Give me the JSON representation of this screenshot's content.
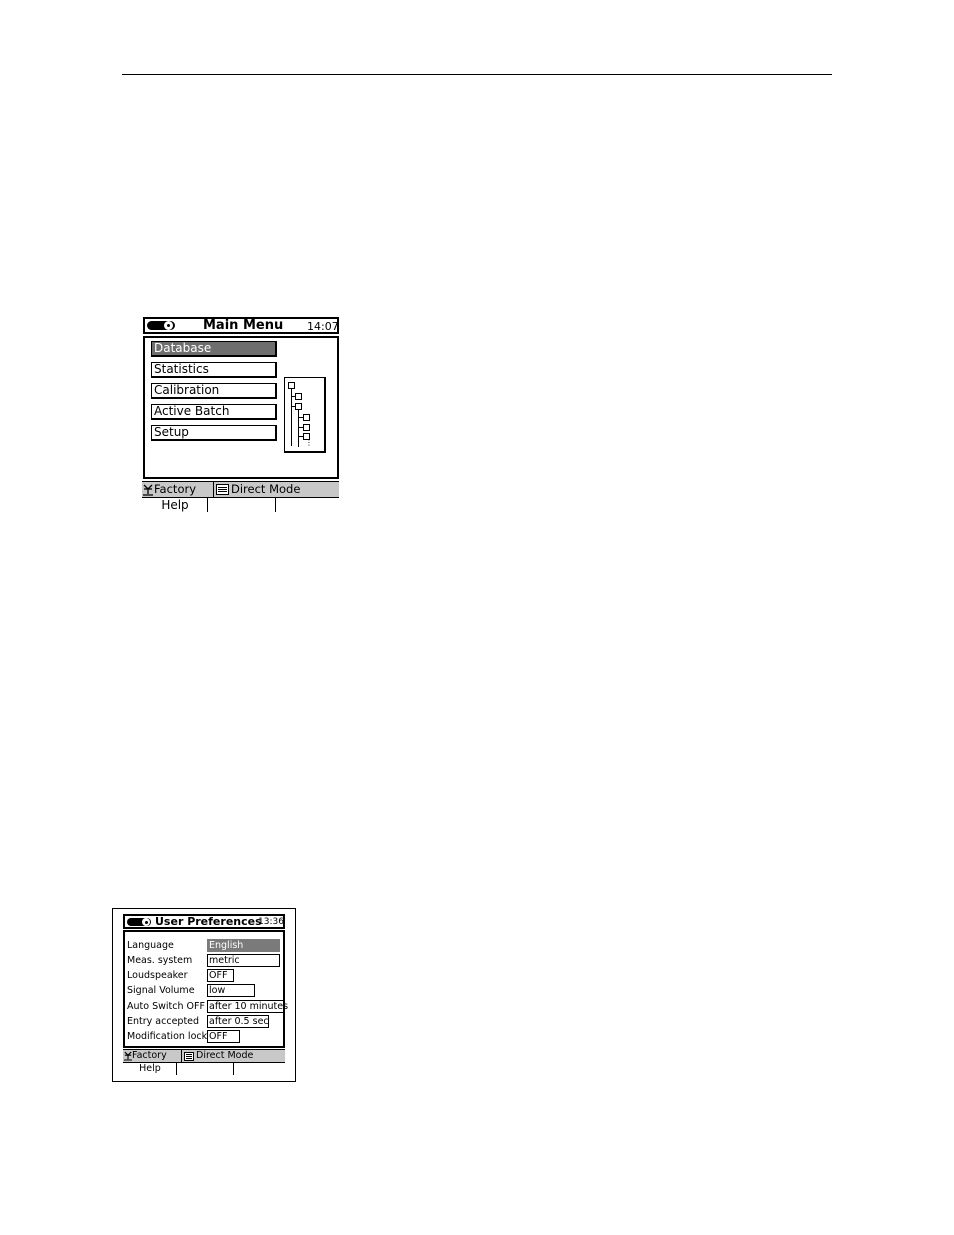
{
  "main_menu_screen": {
    "title": "Main Menu",
    "time": "14:07",
    "menu_items": [
      {
        "label": "Database",
        "selected": true
      },
      {
        "label": "Statistics",
        "selected": false
      },
      {
        "label": "Calibration",
        "selected": false
      },
      {
        "label": "Active Batch",
        "selected": false
      },
      {
        "label": "Setup",
        "selected": false
      }
    ],
    "status": {
      "user": "Factory",
      "mode": "Direct Mode"
    },
    "softkeys": [
      "Help",
      "",
      ""
    ]
  },
  "user_preferences_screen": {
    "title": "User Preferences",
    "time": "13:36",
    "rows": [
      {
        "label": "Language",
        "value": "English",
        "selected": true
      },
      {
        "label": "Meas. system",
        "value": "metric",
        "selected": false
      },
      {
        "label": "Loudspeaker",
        "value": "OFF",
        "selected": false
      },
      {
        "label": "Signal Volume",
        "value": "low",
        "selected": false
      },
      {
        "label": "Auto Switch OFF",
        "value": "after 10 minutes",
        "selected": false
      },
      {
        "label": "Entry accepted",
        "value": "after 0.5 sec",
        "selected": false
      },
      {
        "label": "Modification lock",
        "value": "OFF",
        "selected": false
      }
    ],
    "status": {
      "user": "Factory",
      "mode": "Direct Mode"
    },
    "softkeys": [
      "Help",
      "",
      ""
    ]
  },
  "icons": {
    "battery": "battery-icon",
    "user": "antenna-user-icon",
    "mode": "book-icon",
    "tree": "tree-structure-icon"
  }
}
